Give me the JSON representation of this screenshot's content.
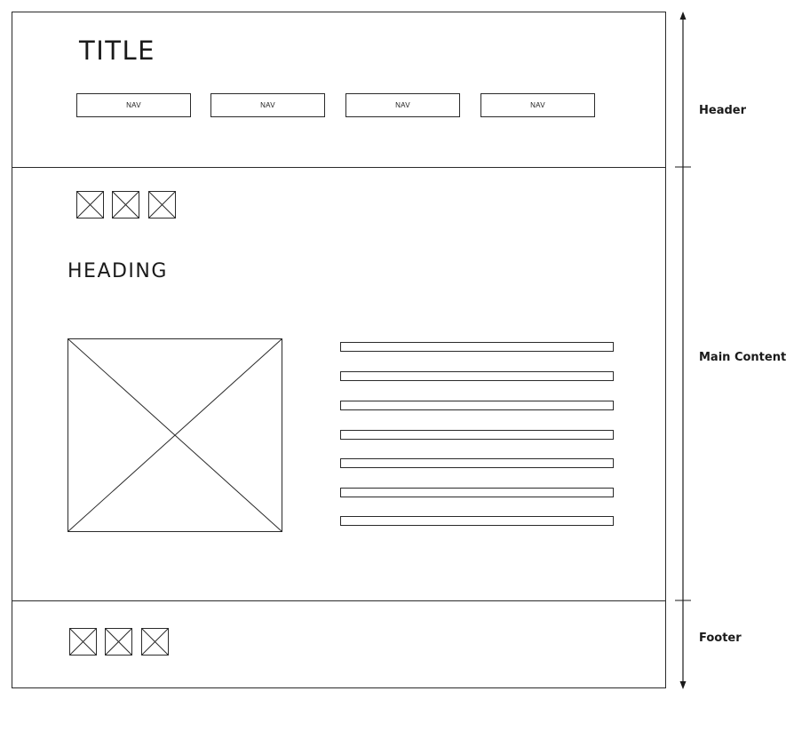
{
  "header": {
    "title": "TITLE",
    "nav_items": [
      "NAV",
      "NAV",
      "NAV",
      "NAV"
    ]
  },
  "main": {
    "heading": "HEADING",
    "icon_placeholders": 3,
    "image_placeholder": "image",
    "text_lines": 7
  },
  "footer": {
    "icon_placeholders": 3
  },
  "annotations": {
    "header_label": "Header",
    "main_label": "Main Content",
    "footer_label": "Footer"
  }
}
